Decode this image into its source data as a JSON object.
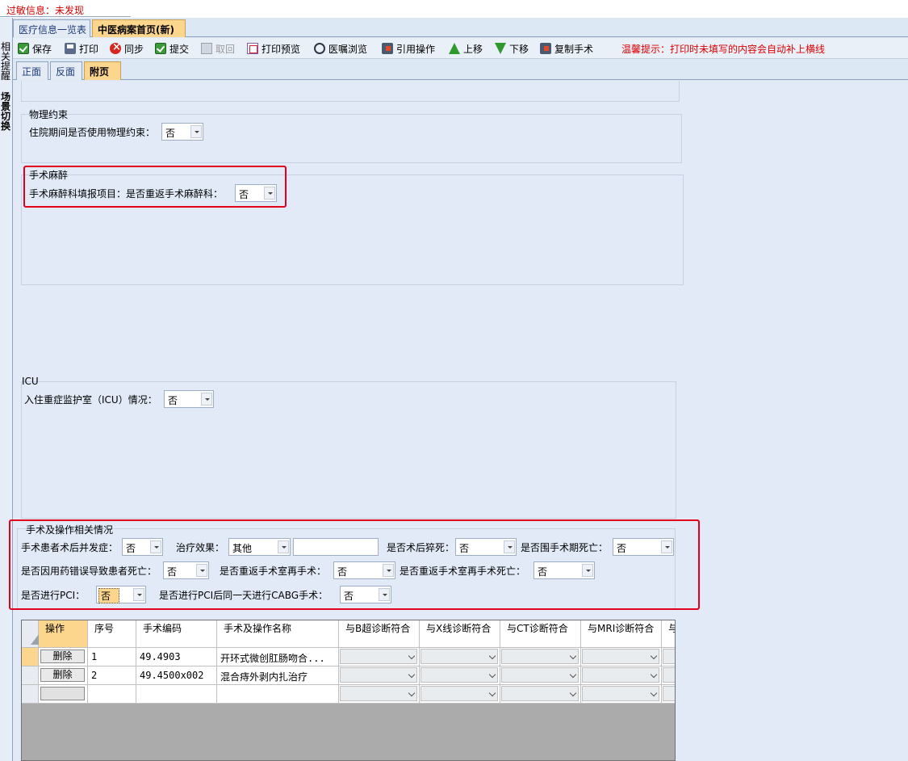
{
  "status": {
    "text": "过敏信息：未发现"
  },
  "side": {
    "tab1": "相关提醒",
    "tab2": "场景切换"
  },
  "main_tabs": [
    "医疗信息一览表",
    "中医病案首页(新)"
  ],
  "toolbar": {
    "items": [
      {
        "label": "保存",
        "icon": "check-icon"
      },
      {
        "label": "打印",
        "icon": "print-icon"
      },
      {
        "label": "同步",
        "icon": "sync-icon"
      },
      {
        "label": "提交",
        "icon": "check-icon"
      },
      {
        "label": "取回",
        "icon": "retrieve-icon"
      },
      {
        "label": "打印预览",
        "icon": "print-preview-icon"
      },
      {
        "label": "医嘱浏览",
        "icon": "magnifier-icon"
      },
      {
        "label": "引用操作",
        "icon": "operation-icon"
      },
      {
        "label": "上移",
        "icon": "arrow-up-icon"
      },
      {
        "label": "下移",
        "icon": "arrow-down-icon"
      },
      {
        "label": "复制手术",
        "icon": "copy-surgery-icon"
      }
    ],
    "tip": "温馨提示：打印时未填写的内容会自动补上横线"
  },
  "sub_tabs": [
    "正面",
    "反面",
    "附页"
  ],
  "physical_restraint": {
    "title": "物理约束",
    "label": "住院期间是否使用物理约束：",
    "value": "否"
  },
  "anesthesia": {
    "title": "手术麻醉",
    "label": "手术麻醉科填报项目：是否重返手术麻醉科：",
    "value": "否"
  },
  "icu": {
    "title": "ICU",
    "label": "入住重症监护室（ICU）情况：",
    "value": "否"
  },
  "surgery": {
    "title": "手术及操作相关情况",
    "complication_label": "手术患者术后并发症：",
    "complication_value": "否",
    "effect_label": "治疗效果：",
    "effect_value": "其他",
    "sudden_death_label": "是否术后猝死：",
    "sudden_death_value": "否",
    "periop_death_label": "是否围手术期死亡：",
    "periop_death_value": "否",
    "drug_error_label": "是否因用药错误导致患者死亡：",
    "drug_error_value": "否",
    "return_or_label": "是否重返手术室再手术：",
    "return_or_value": "否",
    "return_or_death_label": "是否重返手术室再手术死亡：",
    "return_or_death_value": "",
    "pci_label": "是否进行PCI：",
    "pci_value": "否",
    "cabg_label": "是否进行PCI后同一天进行CABG手术：",
    "cabg_value": "否"
  },
  "grid": {
    "headers": [
      "操作",
      "序号",
      "手术编码",
      "手术及操作名称",
      "与B超诊断符合",
      "与X线诊断符合",
      "与CT诊断符合",
      "与MRI诊断符合",
      "与"
    ],
    "delete_label": "删除",
    "rows": [
      {
        "no": "1",
        "code": "49.4903",
        "name": "开环式微创肛肠吻合..."
      },
      {
        "no": "2",
        "code": "49.4500x002",
        "name": "混合痔外剥内扎治疗"
      }
    ]
  }
}
